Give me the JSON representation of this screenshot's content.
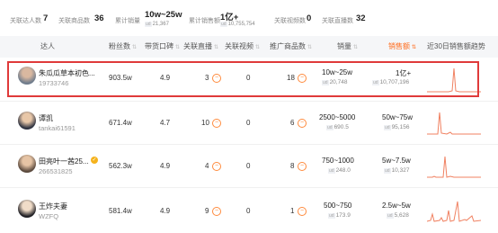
{
  "summary": [
    {
      "label": "关联达人数",
      "value": "7"
    },
    {
      "label": "关联商品数",
      "value": "36"
    },
    {
      "label": "累计销量",
      "value": "10w~25w",
      "sub_tag": "ud",
      "sub": "21,367"
    },
    {
      "label": "累计销售额",
      "value": "1亿+",
      "sub_tag": "ud",
      "sub": "10,755,754"
    },
    {
      "label": "关联视频数",
      "value": "0"
    },
    {
      "label": "关联直播数",
      "value": "32"
    }
  ],
  "columns": [
    "达人",
    "粉丝数",
    "带货口碑",
    "关联直播",
    "关联视频",
    "推广商品数",
    "销量",
    "销售额",
    "近30日销售额趋势"
  ],
  "rows": [
    {
      "name": "朱瓜瓜草本初色...",
      "id": "19733746",
      "fans": "903.5w",
      "rating": "4.9",
      "live": "3",
      "video": "0",
      "products": "18",
      "sales": "10w~25w",
      "sales_sub": "20,748",
      "revenue": "1亿+",
      "revenue_sub": "10,707,196",
      "verified": false
    },
    {
      "name": "谭凯",
      "id": "tankai61591",
      "fans": "671.4w",
      "rating": "4.7",
      "live": "10",
      "video": "0",
      "products": "6",
      "sales": "2500~5000",
      "sales_sub": "690.5",
      "revenue": "50w~75w",
      "revenue_sub": "95,156",
      "verified": true
    },
    {
      "name": "田亮叶一茜25...",
      "id": "266531825",
      "fans": "562.3w",
      "rating": "4.9",
      "live": "4",
      "video": "0",
      "products": "8",
      "sales": "750~1000",
      "sales_sub": "248.0",
      "revenue": "5w~7.5w",
      "revenue_sub": "10,327",
      "verified": true
    },
    {
      "name": "王炸夫妻",
      "id": "WZFQ",
      "fans": "581.4w",
      "rating": "4.9",
      "live": "9",
      "video": "0",
      "products": "1",
      "sales": "500~750",
      "sales_sub": "173.9",
      "revenue": "2.5w~5w",
      "revenue_sub": "5,628",
      "verified": false
    }
  ],
  "sub_tag": "ud",
  "expand_glyph": "−",
  "sort_arrow": "⇅",
  "check_glyph": "✓",
  "colors": {
    "accent": "#ff6a1a",
    "highlight": "#e03a3a",
    "trend": "#f08060"
  }
}
